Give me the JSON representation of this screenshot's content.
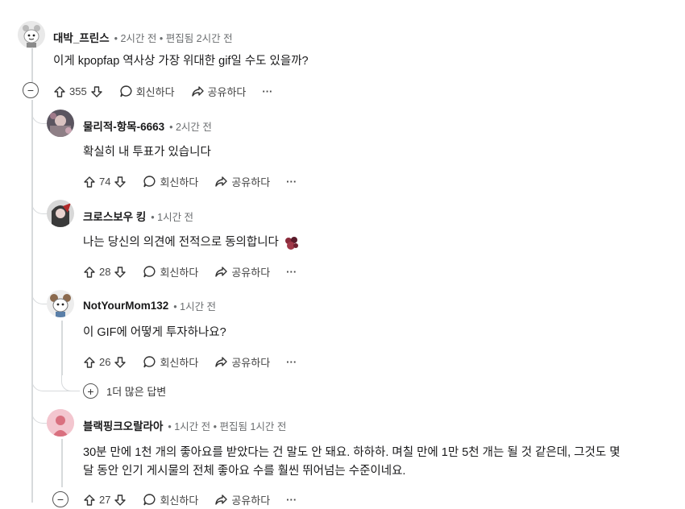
{
  "comments": [
    {
      "user": "대박_프린스",
      "meta": "• 2시간 전 • 편집됨 2시간 전",
      "text": "이게 kpopfap 역사상 가장 위대한 gif일 수도 있을까?",
      "votes": "355",
      "reply": "회신하다",
      "share": "공유하다",
      "more": "···"
    },
    {
      "user": "물리적-항목-6663",
      "meta": "• 2시간 전",
      "text": "확실히 내 투표가 있습니다",
      "votes": "74",
      "reply": "회신하다",
      "share": "공유하다",
      "more": "···"
    },
    {
      "user": "크로스보우 킹",
      "meta": "• 1시간 전",
      "text": "나는 당신의 의견에 전적으로 동의합니다",
      "votes": "28",
      "reply": "회신하다",
      "share": "공유하다",
      "more": "···"
    },
    {
      "user": "NotYourMom132",
      "meta": "• 1시간 전",
      "text": "이 GIF에 어떻게 투자하나요?",
      "votes": "26",
      "reply": "회신하다",
      "share": "공유하다",
      "more": "···"
    },
    {
      "user": "블랙핑크오랄라아",
      "meta": "• 1시간 전 • 편집됨 1시간 전",
      "text_line1": "30분 만에 1천 개의 좋아요를 받았다는 건 말도 안 돼요. 하하하. 며칠 만에 1만 5천 개는 될 것 같은데, 그것도 몇",
      "text_line2": "달 동안 인기 게시물의 전체 좋아요 수를 훨씬 뛰어넘는 수준이네요.",
      "votes": "27",
      "reply": "회신하다",
      "share": "공유하다",
      "more": "···"
    }
  ],
  "more_replies": "1더 많은 답변",
  "icons": [
    "collapse-icon",
    "upvote-icon",
    "downvote-icon",
    "reply-bubble-icon",
    "share-arrow-icon",
    "more-icon",
    "expand-plus-icon",
    "emoji-icon"
  ]
}
